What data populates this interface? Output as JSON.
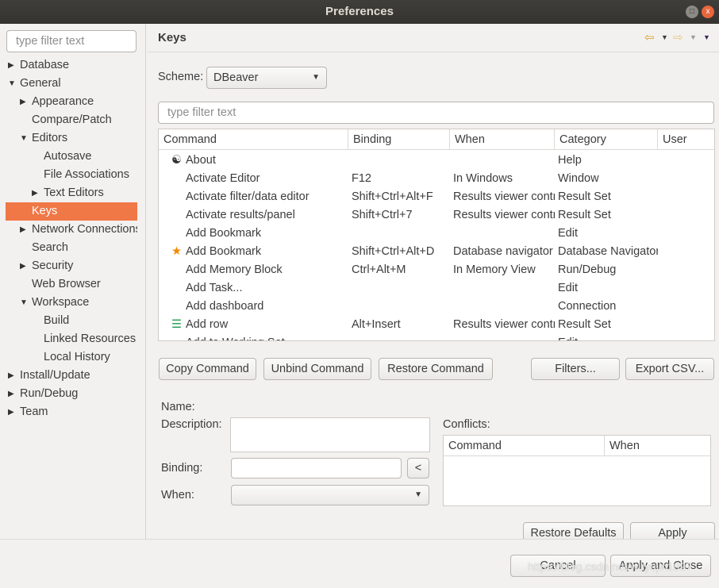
{
  "window": {
    "title": "Preferences",
    "minimize_icon": "restore-icon",
    "close_icon": "close-icon"
  },
  "sidebar": {
    "filter_placeholder": "type filter text",
    "items": [
      {
        "label": "Database",
        "level": 0,
        "expander": "collapsed"
      },
      {
        "label": "General",
        "level": 0,
        "expander": "expanded"
      },
      {
        "label": "Appearance",
        "level": 1,
        "expander": "collapsed"
      },
      {
        "label": "Compare/Patch",
        "level": 1,
        "expander": "none"
      },
      {
        "label": "Editors",
        "level": 1,
        "expander": "expanded"
      },
      {
        "label": "Autosave",
        "level": 2,
        "expander": "none"
      },
      {
        "label": "File Associations",
        "level": 2,
        "expander": "none"
      },
      {
        "label": "Text Editors",
        "level": 2,
        "expander": "collapsed"
      },
      {
        "label": "Keys",
        "level": 1,
        "expander": "none",
        "selected": true
      },
      {
        "label": "Network Connections",
        "level": 1,
        "expander": "collapsed"
      },
      {
        "label": "Search",
        "level": 1,
        "expander": "none"
      },
      {
        "label": "Security",
        "level": 1,
        "expander": "collapsed"
      },
      {
        "label": "Web Browser",
        "level": 1,
        "expander": "none"
      },
      {
        "label": "Workspace",
        "level": 1,
        "expander": "expanded"
      },
      {
        "label": "Build",
        "level": 2,
        "expander": "none"
      },
      {
        "label": "Linked Resources",
        "level": 2,
        "expander": "none"
      },
      {
        "label": "Local History",
        "level": 2,
        "expander": "none"
      },
      {
        "label": "Install/Update",
        "level": 0,
        "expander": "collapsed"
      },
      {
        "label": "Run/Debug",
        "level": 0,
        "expander": "collapsed"
      },
      {
        "label": "Team",
        "level": 0,
        "expander": "collapsed"
      }
    ]
  },
  "page": {
    "title": "Keys",
    "scheme_label": "Scheme:",
    "scheme_value": "DBeaver",
    "filter_placeholder": "type filter text"
  },
  "table": {
    "columns": [
      "Command",
      "Binding",
      "When",
      "Category",
      "User"
    ],
    "rows": [
      {
        "icon": "about-icon",
        "command": "About",
        "binding": "",
        "when": "",
        "category": "Help",
        "user": ""
      },
      {
        "icon": "",
        "command": "Activate Editor",
        "binding": "F12",
        "when": "In Windows",
        "category": "Window",
        "user": ""
      },
      {
        "icon": "",
        "command": "Activate filter/data editor",
        "binding": "Shift+Ctrl+Alt+F",
        "when": "Results viewer control",
        "category": "Result Set",
        "user": ""
      },
      {
        "icon": "",
        "command": "Activate results/panel",
        "binding": "Shift+Ctrl+7",
        "when": "Results viewer control",
        "category": "Result Set",
        "user": ""
      },
      {
        "icon": "",
        "command": "Add Bookmark",
        "binding": "",
        "when": "",
        "category": "Edit",
        "user": ""
      },
      {
        "icon": "star-icon",
        "command": "Add Bookmark",
        "binding": "Shift+Ctrl+Alt+D",
        "when": "Database navigator",
        "category": "Database Navigator",
        "user": ""
      },
      {
        "icon": "",
        "command": "Add Memory Block",
        "binding": "Ctrl+Alt+M",
        "when": "In Memory View",
        "category": "Run/Debug",
        "user": ""
      },
      {
        "icon": "",
        "command": "Add Task...",
        "binding": "",
        "when": "",
        "category": "Edit",
        "user": ""
      },
      {
        "icon": "",
        "command": "Add dashboard",
        "binding": "",
        "when": "",
        "category": "Connection",
        "user": ""
      },
      {
        "icon": "add-row-icon",
        "command": "Add row",
        "binding": "Alt+Insert",
        "when": "Results viewer control",
        "category": "Result Set",
        "user": ""
      },
      {
        "icon": "",
        "command": "Add to Working Set",
        "binding": "",
        "when": "",
        "category": "Edit",
        "user": ""
      }
    ]
  },
  "buttons": {
    "copy": "Copy Command",
    "unbind": "Unbind Command",
    "restore": "Restore Command",
    "filters": "Filters...",
    "export": "Export CSV...",
    "restore_defaults": "Restore Defaults",
    "apply": "Apply",
    "cancel": "Cancel",
    "apply_close": "Apply and Close"
  },
  "details": {
    "name_label": "Name:",
    "description_label": "Description:",
    "binding_label": "Binding:",
    "when_label": "When:",
    "conflicts_label": "Conflicts:",
    "conflict_columns": [
      "Command",
      "When"
    ]
  },
  "watermark": "https://blog.csdn.net/wuyujin1997",
  "colors": {
    "selection": "#f07746",
    "titlebar": "#3b3935"
  }
}
